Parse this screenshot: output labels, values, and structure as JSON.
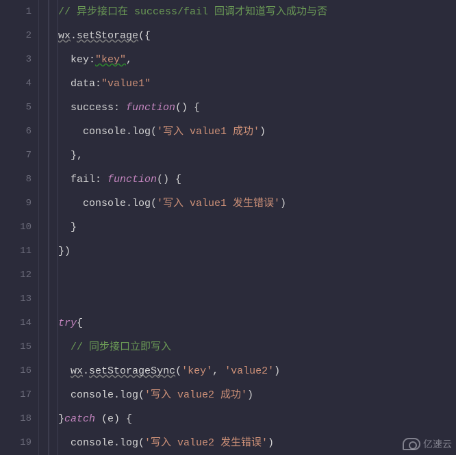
{
  "lines": [
    {
      "num": "1"
    },
    {
      "num": "2"
    },
    {
      "num": "3"
    },
    {
      "num": "4"
    },
    {
      "num": "5"
    },
    {
      "num": "6"
    },
    {
      "num": "7"
    },
    {
      "num": "8"
    },
    {
      "num": "9"
    },
    {
      "num": "10"
    },
    {
      "num": "11"
    },
    {
      "num": "12"
    },
    {
      "num": "13"
    },
    {
      "num": "14"
    },
    {
      "num": "15"
    },
    {
      "num": "16"
    },
    {
      "num": "17"
    },
    {
      "num": "18"
    },
    {
      "num": "19"
    }
  ],
  "code": {
    "l1": {
      "comment": "// 异步接口在 success/fail 回调才知道写入成功与否"
    },
    "l2": {
      "obj": "wx",
      "dot": ".",
      "method": "setStorage",
      "paren": "({"
    },
    "l3": {
      "key": "  key:",
      "str": "\"key\"",
      "tail": ","
    },
    "l4": {
      "key": "  data:",
      "str": "\"value1\""
    },
    "l5": {
      "key": "  success: ",
      "fn": "function",
      "tail": "() {"
    },
    "l6": {
      "pre": "    console.log(",
      "str": "'写入 value1 成功'",
      "tail": ")"
    },
    "l7": {
      "txt": "  },"
    },
    "l8": {
      "key": "  fail: ",
      "fn": "function",
      "tail": "() {"
    },
    "l9": {
      "pre": "    console.log(",
      "str": "'写入 value1 发生错误'",
      "tail": ")"
    },
    "l10": {
      "txt": "  }"
    },
    "l11": {
      "txt": "})"
    },
    "l12": {
      "txt": ""
    },
    "l13": {
      "txt": ""
    },
    "l14": {
      "kw": "try",
      "tail": "{"
    },
    "l15": {
      "comment": "  // 同步接口立即写入"
    },
    "l16": {
      "pre": "  ",
      "obj": "wx",
      "dot": ".",
      "method": "setStorageSync",
      "paren": "(",
      "str1": "'key'",
      "comma": ", ",
      "str2": "'value2'",
      "close": ")"
    },
    "l17": {
      "pre": "  console.log(",
      "str": "'写入 value2 成功'",
      "tail": ")"
    },
    "l18": {
      "close": "}",
      "kw": "catch",
      "tail": " (e) {"
    },
    "l19": {
      "pre": "  console.log(",
      "str": "'写入 value2 发生错误'",
      "tail": ")"
    }
  },
  "watermark": {
    "text": "亿速云"
  }
}
